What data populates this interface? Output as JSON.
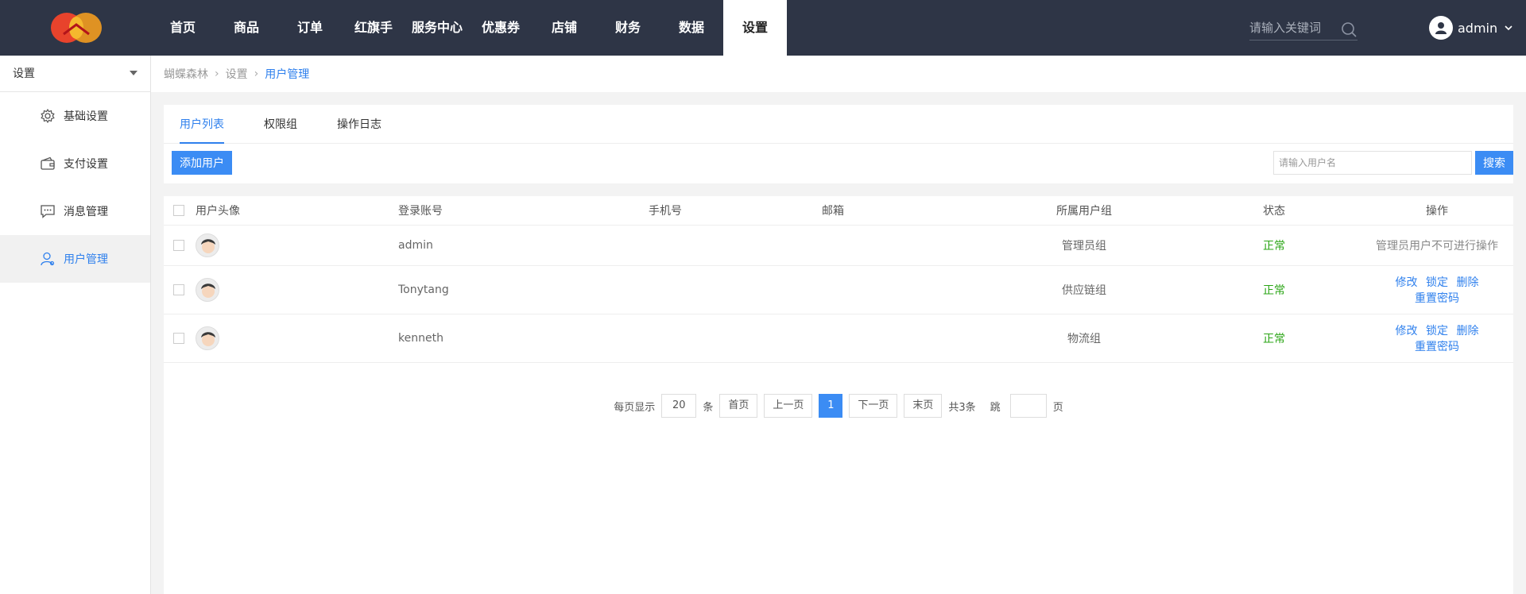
{
  "header": {
    "nav": [
      "首页",
      "商品",
      "订单",
      "红旗手",
      "服务中心",
      "优惠券",
      "店铺",
      "财务",
      "数据",
      "设置"
    ],
    "active_nav": "设置",
    "search_placeholder": "请输入关键词",
    "user": "admin"
  },
  "sidebar": {
    "select_label": "设置",
    "items": [
      {
        "label": "基础设置",
        "icon": "gear-icon"
      },
      {
        "label": "支付设置",
        "icon": "wallet-icon"
      },
      {
        "label": "消息管理",
        "icon": "message-icon"
      },
      {
        "label": "用户管理",
        "icon": "user-icon"
      }
    ],
    "active": "用户管理"
  },
  "breadcrumb": [
    "蝴蝶森林",
    "设置",
    "用户管理"
  ],
  "tabs": [
    "用户列表",
    "权限组",
    "操作日志"
  ],
  "active_tab": "用户列表",
  "toolbar": {
    "add_label": "添加用户",
    "search_placeholder": "请输入用户名",
    "search_label": "搜索"
  },
  "table": {
    "headers": [
      "用户头像",
      "登录账号",
      "手机号",
      "邮箱",
      "所属用户组",
      "状态",
      "操作"
    ],
    "rows": [
      {
        "account": "admin",
        "phone": "",
        "email": "",
        "group": "管理员组",
        "status": "正常",
        "note": "管理员用户不可进行操作"
      },
      {
        "account": "Tonytang",
        "phone": "",
        "email": "",
        "group": "供应链组",
        "status": "正常"
      },
      {
        "account": "kenneth",
        "phone": "",
        "email": "",
        "group": "物流组",
        "status": "正常"
      }
    ],
    "ops": {
      "edit": "修改",
      "lock": "锁定",
      "delete": "删除",
      "reset": "重置密码"
    }
  },
  "pager": {
    "per_page_label": "每页显示",
    "per_page": "20",
    "per_page_unit": "条",
    "first": "首页",
    "prev": "上一页",
    "current": "1",
    "next": "下一页",
    "last": "末页",
    "total": "共3条",
    "jump_label": "跳",
    "page_unit": "页"
  },
  "colors": {
    "topbar": "#2e3546",
    "accent": "#2f80ed",
    "button": "#3b8cf4",
    "status_ok": "#2aa515"
  }
}
